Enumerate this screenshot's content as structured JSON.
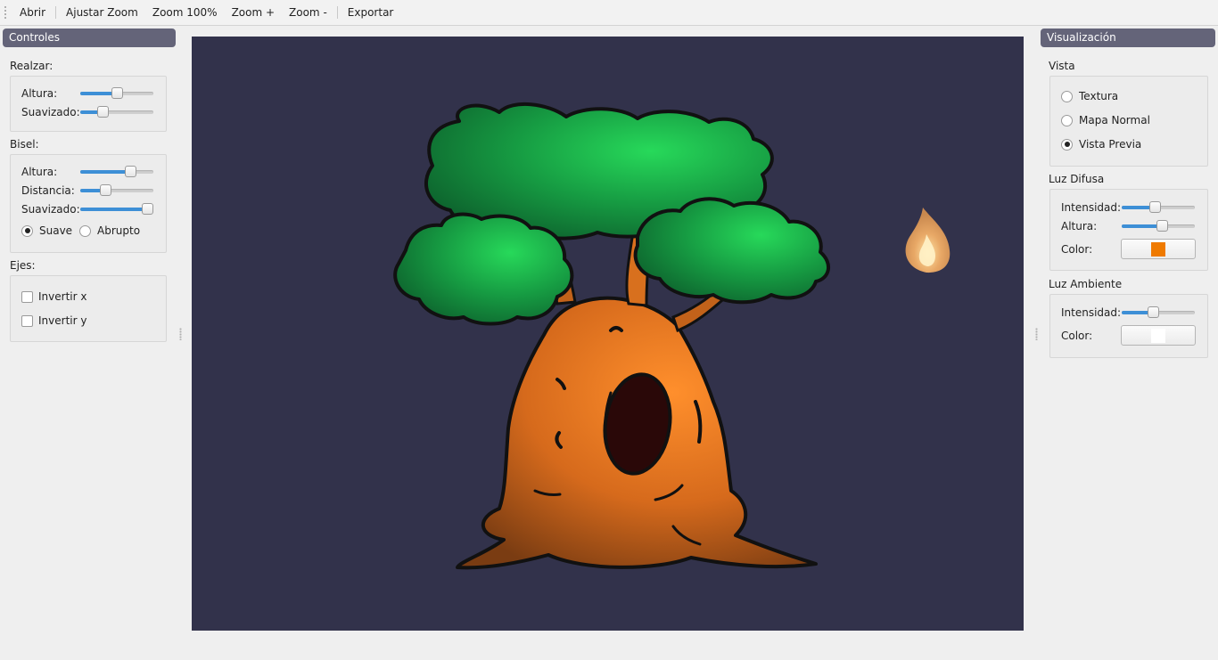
{
  "toolbar": {
    "items": [
      "Abrir",
      "Ajustar Zoom",
      "Zoom 100%",
      "Zoom +",
      "Zoom -",
      "Exportar"
    ]
  },
  "left_panel": {
    "title": "Controles",
    "realzar": {
      "label": "Realzar:",
      "altura_label": "Altura:",
      "altura_value": 0.5,
      "suavizado_label": "Suavizado:",
      "suavizado_value": 0.28
    },
    "bisel": {
      "label": "Bisel:",
      "altura_label": "Altura:",
      "altura_value": 0.73,
      "distancia_label": "Distancia:",
      "distancia_value": 0.32,
      "suavizado_label": "Suavizado:",
      "suavizado_value": 1.0,
      "suave_label": "Suave",
      "abrupto_label": "Abrupto",
      "selected": "Suave"
    },
    "ejes": {
      "label": "Ejes:",
      "invertir_x_label": "Invertir x",
      "invertir_x": false,
      "invertir_y_label": "Invertir y",
      "invertir_y": false
    }
  },
  "right_panel": {
    "title": "Visualización",
    "vista": {
      "label": "Vista",
      "options": [
        "Textura",
        "Mapa Normal",
        "Vista Previa"
      ],
      "selected": "Vista Previa"
    },
    "luz_difusa": {
      "label": "Luz Difusa",
      "intensidad_label": "Intensidad:",
      "intensidad_value": 0.45,
      "altura_label": "Altura:",
      "altura_value": 0.57,
      "color_label": "Color:",
      "color": "#ef7a00"
    },
    "luz_ambiente": {
      "label": "Luz Ambiente",
      "intensidad_label": "Intensidad:",
      "intensidad_value": 0.42,
      "color_label": "Color:",
      "color": "#ffffff"
    }
  },
  "canvas": {
    "background": "#32324b",
    "image": "tree-sprite",
    "light_icon": "flame-icon"
  }
}
